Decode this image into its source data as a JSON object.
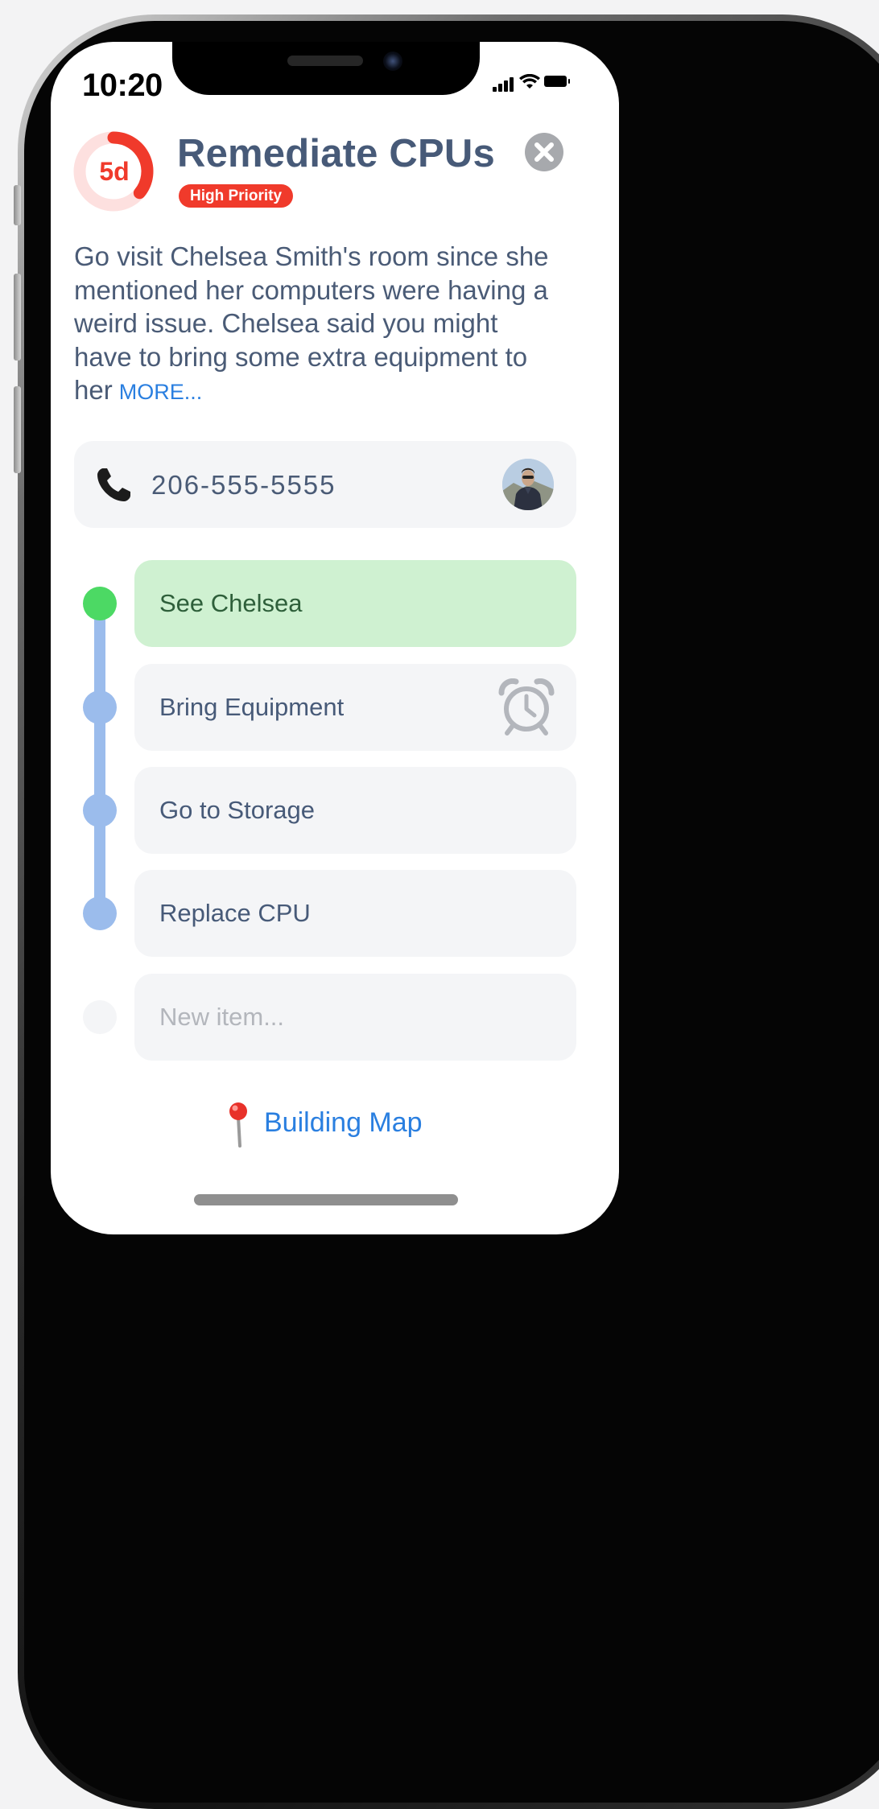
{
  "status_bar": {
    "time": "10:20"
  },
  "task": {
    "due_label": "5d",
    "due_progress": 0.36,
    "title": "Remediate CPUs",
    "priority": "High Priority",
    "description": "Go visit Chelsea Smith's room since she mentioned her computers were having a weird issue.  Chelsea said you might have to bring some extra equipment to her",
    "more_label": "MORE..."
  },
  "contact": {
    "phone": "206-555-5555",
    "icon": "phone-icon"
  },
  "checklist": {
    "items": [
      {
        "label": "See Chelsea",
        "state": "done"
      },
      {
        "label": "Bring Equipment",
        "state": "pending",
        "has_alarm": true
      },
      {
        "label": "Go to Storage",
        "state": "pending"
      },
      {
        "label": "Replace CPU",
        "state": "pending"
      }
    ],
    "new_item_placeholder": "New item..."
  },
  "map": {
    "label": "Building Map"
  },
  "colors": {
    "accent": "#2a7fe0",
    "priority": "#f03a2b",
    "done": "#4cd964",
    "pending": "#9bbcec",
    "title": "#475a78"
  }
}
